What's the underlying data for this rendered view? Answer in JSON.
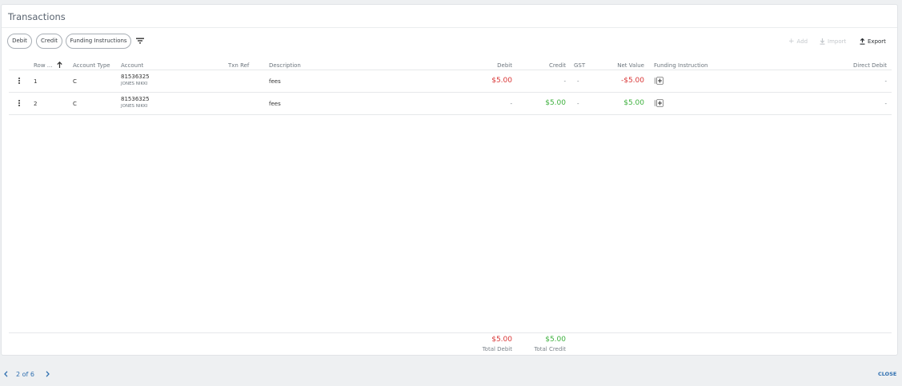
{
  "panel": {
    "title": "Transactions"
  },
  "filters": {
    "debit": "Debit",
    "credit": "Credit",
    "funding": "Funding Instructions"
  },
  "toolbar": {
    "add": "Add",
    "import": "Import",
    "export": "Export"
  },
  "columns": {
    "row": "Row ...",
    "account_type": "Account Type",
    "account": "Account",
    "txn_ref": "Txn Ref",
    "description": "Description",
    "debit": "Debit",
    "credit": "Credit",
    "gst": "GST",
    "net_value": "Net Value",
    "funding_instruction": "Funding Instruction",
    "direct_debit": "Direct Debit"
  },
  "rows": [
    {
      "row": "1",
      "account_type": "C",
      "account_number": "81536325",
      "account_name": "JONES NIKKI",
      "description": "fees",
      "debit": "$5.00",
      "credit": "-",
      "gst": "-",
      "net_value": "-$5.00",
      "direct_debit": "-"
    },
    {
      "row": "2",
      "account_type": "C",
      "account_number": "81536325",
      "account_name": "JONES NIKKI",
      "description": "fees",
      "debit": "-",
      "credit": "$5.00",
      "gst": "-",
      "net_value": "$5.00",
      "direct_debit": "-"
    }
  ],
  "totals": {
    "debit_value": "$5.00",
    "debit_label": "Total Debit",
    "credit_value": "$5.00",
    "credit_label": "Total Credit"
  },
  "pagination": {
    "text": "2 of 6"
  },
  "footer": {
    "close": "CLOSE"
  },
  "colors": {
    "debit": "#d93636",
    "credit": "#3db03d",
    "link": "#2f6fb0"
  },
  "icons": [
    "filter-icon",
    "plus-icon",
    "download-icon",
    "upload-icon",
    "sort-ascending-icon",
    "more-vertical-icon",
    "add-box-icon",
    "chevron-left-icon",
    "chevron-right-icon"
  ]
}
